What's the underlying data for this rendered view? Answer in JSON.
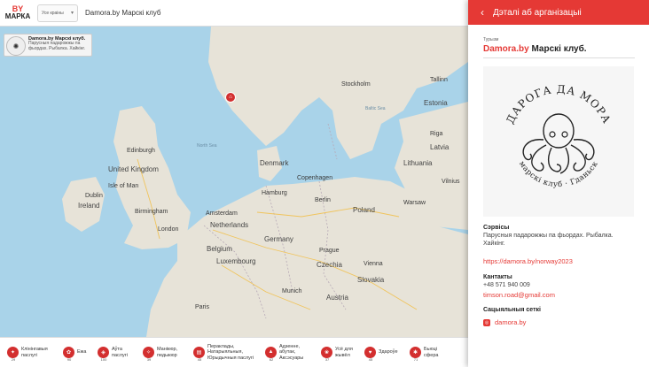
{
  "topbar": {
    "logo_by": "BY",
    "logo_marka": "МАРКА",
    "country_select": "Усе краіны",
    "search_value": "Damora.by Марскі клуб"
  },
  "popup": {
    "title": "Damora.by Марскі клуб.",
    "desc": "Парусныя падарожжы па фьордах. Рыбалка. Хайкінг."
  },
  "map_labels": [
    {
      "text": "Stockholm"
    },
    {
      "text": "Tallinn"
    },
    {
      "text": "Estonia"
    },
    {
      "text": "Riga"
    },
    {
      "text": "Latvia"
    },
    {
      "text": "Lithuania"
    },
    {
      "text": "Vilnius"
    },
    {
      "text": "Denmark"
    },
    {
      "text": "Copenhagen"
    },
    {
      "text": "Hamburg"
    },
    {
      "text": "Berlin"
    },
    {
      "text": "Poland"
    },
    {
      "text": "Warsaw"
    },
    {
      "text": "Edinburgh"
    },
    {
      "text": "United Kingdom"
    },
    {
      "text": "Isle of Man"
    },
    {
      "text": "Dublin"
    },
    {
      "text": "Ireland"
    },
    {
      "text": "Birmingham"
    },
    {
      "text": "London"
    },
    {
      "text": "Amsterdam"
    },
    {
      "text": "Netherlands"
    },
    {
      "text": "Belgium"
    },
    {
      "text": "Luxembourg"
    },
    {
      "text": "Germany"
    },
    {
      "text": "Prague"
    },
    {
      "text": "Czechia"
    },
    {
      "text": "Slovakia"
    },
    {
      "text": "Austria"
    },
    {
      "text": "Paris"
    },
    {
      "text": "Munich"
    },
    {
      "text": "Vienna"
    },
    {
      "text": "North Sea"
    },
    {
      "text": "Baltic Sea"
    }
  ],
  "categories": [
    {
      "label": "Клінінгавыя паслугі",
      "count": "29"
    },
    {
      "label": "Ежа",
      "count": "90"
    },
    {
      "label": "Аўта паслугі",
      "count": "100"
    },
    {
      "label": "Манікюр, педыкюр",
      "count": "39"
    },
    {
      "label": "Пераклады, Натарыяльныя, Юрыдычныя паслугі",
      "count": "45"
    },
    {
      "label": "Адзенне, абутак, Аксэсуары",
      "count": "62"
    },
    {
      "label": "Усё для жывёл",
      "count": "37"
    },
    {
      "label": "Здароўе",
      "count": "45"
    },
    {
      "label": "Бьюці сфера",
      "count": "71"
    }
  ],
  "panel": {
    "header_title": "Дэталі аб арганізацыі",
    "category": "Турызм",
    "org_brand": "Damora.by",
    "org_rest": " Марскі клуб.",
    "logo_top": "ДАРОГА ДА МОРА",
    "logo_bottom": "марскі клуб · Гданьск",
    "services_title": "Сэрвісы",
    "services_text": "Парусныя падарожжы па фьордах. Рыбалка. Хайкінг.",
    "website": "https://damora.by/norway2023",
    "contacts_title": "Кантакты",
    "phone": "+48 571 940 009",
    "email": "timson.road@gmail.com",
    "social_title": "Сацыяльныя сеткі",
    "social_link": "damora.by"
  },
  "colors": {
    "accent": "#e53935",
    "water": "#a9d3e9",
    "land": "#e7e3d8"
  }
}
